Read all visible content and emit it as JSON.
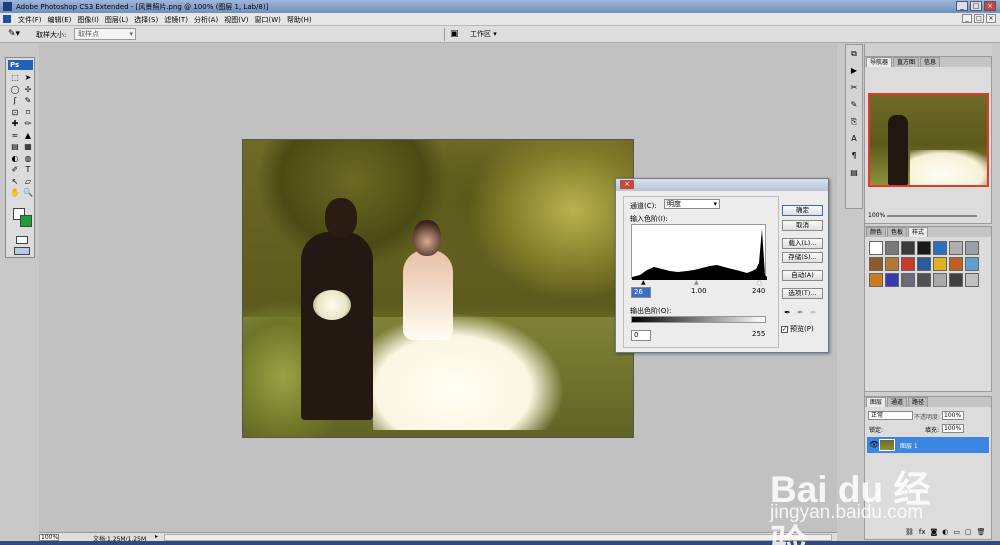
{
  "window": {
    "title": "Adobe Photoshop CS3 Extended - [风景照片.png @ 100% (图层 1, Lab/8)]",
    "minimize": "_",
    "maximize": "□",
    "close": "×"
  },
  "menu": {
    "items": [
      "文件(F)",
      "编辑(E)",
      "图像(I)",
      "图层(L)",
      "选择(S)",
      "滤镜(T)",
      "分析(A)",
      "视图(V)",
      "窗口(W)",
      "帮助(H)"
    ]
  },
  "options": {
    "sample_size_label": "取样大小:",
    "sample_size_value": "取样点",
    "workspace_label": "工作区 ▾"
  },
  "toolbox": {
    "logo": "Ps",
    "tools": [
      "⬚",
      "➤",
      "◯",
      "✢",
      "ʃ",
      "✎",
      "⊡",
      "⌑",
      "✚",
      "✏",
      "≈",
      "▲",
      "▤",
      "▦",
      "◐",
      "◍",
      "✐",
      "T",
      "↖",
      "▱",
      "✋",
      "🔍"
    ]
  },
  "levels_dialog": {
    "title": "色阶",
    "close": "×",
    "channel_label": "通道(C):",
    "channel_value": "明度",
    "input_label": "输入色阶(I):",
    "input_black": "26",
    "input_gamma": "1.00",
    "input_white": "240",
    "output_label": "输出色阶(O):",
    "output_black": "0",
    "output_white": "255",
    "buttons": {
      "ok": "确定",
      "cancel": "取消",
      "load": "载入(L)...",
      "save": "存储(S)...",
      "auto": "自动(A)",
      "options": "选项(T)..."
    },
    "preview_label": "预览(P)",
    "preview_checked": true
  },
  "panels": {
    "navigator_tabs": [
      "导航器",
      "直方图",
      "信息"
    ],
    "navigator_zoom": "100%",
    "styles_tabs": [
      "颜色",
      "色板",
      "样式"
    ],
    "style_swatches": [
      "#ffffff",
      "#7a7a7a",
      "#3a3a3a",
      "#1a1a1a",
      "#2f6fbf",
      "#b0b0b0",
      "#9aa0a8",
      "#8a5a2a",
      "#b07a30",
      "#c83a2a",
      "#2a5a9a",
      "#e0b020",
      "#c06020",
      "#60a0d0",
      "#d07a20",
      "#3a3ab0",
      "#6a6a7a",
      "#505050",
      "#a8a8a8",
      "#404040",
      "#c0c0c0"
    ],
    "layers_tabs": [
      "图层",
      "通道",
      "路径"
    ],
    "blend_mode": "正常",
    "opacity_label": "不透明度:",
    "opacity_value": "100%",
    "lock_label": "锁定:",
    "fill_label": "填充:",
    "fill_value": "100%",
    "layer_name": "图层 1"
  },
  "status": {
    "zoom": "100%",
    "doc_info": "文档:1.25M/1.25M"
  },
  "watermark": {
    "brand": "Bai du 经验",
    "url": "jingyan.baidu.com"
  }
}
